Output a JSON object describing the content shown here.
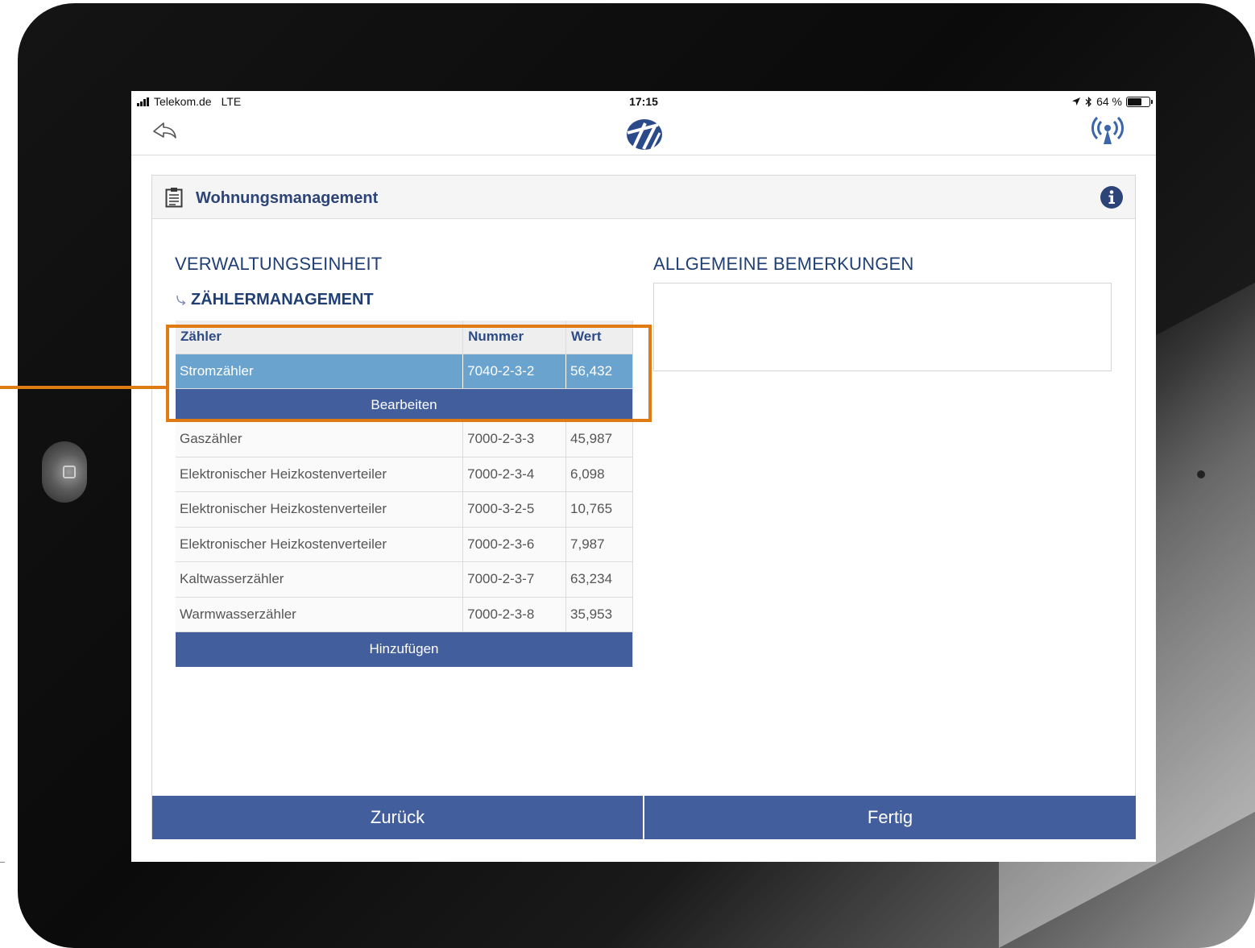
{
  "status_bar": {
    "carrier": "Telekom.de",
    "network": "LTE",
    "time": "17:15",
    "battery": "64 %",
    "battery_level": 0.64
  },
  "navbar": {
    "back_icon": "back-arrow-icon",
    "logo_icon": "brand-logo-icon",
    "connectivity_icon": "antenna-icon"
  },
  "panel": {
    "title": "Wohnungsmanagement",
    "title_icon": "clipboard-icon",
    "info_icon": "info-icon"
  },
  "left_section": {
    "title": "VERWALTUNGSEINHEIT",
    "subtitle": "ZÄHLERMANAGEMENT"
  },
  "table": {
    "headers": [
      "Zähler",
      "Nummer",
      "Wert"
    ],
    "rows": [
      {
        "name": "Stromzähler",
        "number": "7040-2-3-2",
        "value": "56,432",
        "selected": true
      },
      {
        "name": "Gaszähler",
        "number": "7000-2-3-3",
        "value": "45,987"
      },
      {
        "name": "Elektronischer Heizkostenverteiler",
        "number": "7000-2-3-4",
        "value": "6,098"
      },
      {
        "name": "Elektronischer Heizkostenverteiler",
        "number": "7000-3-2-5",
        "value": "10,765"
      },
      {
        "name": "Elektronischer Heizkostenverteiler",
        "number": "7000-2-3-6",
        "value": "7,987"
      },
      {
        "name": "Kaltwasserzähler",
        "number": "7000-2-3-7",
        "value": "63,234"
      },
      {
        "name": "Warmwasserzähler",
        "number": "7000-2-3-8",
        "value": "35,953"
      }
    ],
    "edit_label": "Bearbeiten",
    "add_label": "Hinzufügen"
  },
  "right_section": {
    "title": "ALLGEMEINE BEMERKUNGEN",
    "remarks_value": ""
  },
  "footer": {
    "back_label": "Zurück",
    "done_label": "Fertig"
  },
  "colors": {
    "primary": "#425e9c",
    "selected_row": "#6ba3cf",
    "heading": "#203f74",
    "highlight": "#e07b14"
  }
}
